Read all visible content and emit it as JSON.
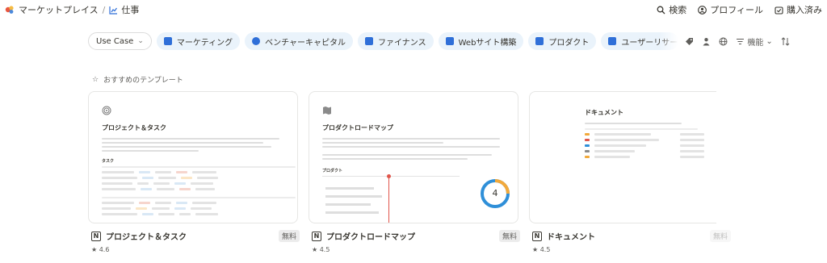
{
  "breadcrumb": {
    "root": "マーケットプレイス",
    "separator": "/",
    "current": "仕事"
  },
  "top_actions": {
    "search": "検索",
    "profile": "プロフィール",
    "purchased": "購入済み"
  },
  "filters": {
    "usecase": "Use Case",
    "chips": [
      {
        "label": "マーケティング",
        "icon": "megaphone-icon"
      },
      {
        "label": "ベンチャーキャピタル",
        "icon": "pie-chart-icon"
      },
      {
        "label": "ファイナンス",
        "icon": "money-icon"
      },
      {
        "label": "Webサイト構築",
        "icon": "monitor-icon"
      },
      {
        "label": "プロダクト",
        "icon": "box-icon"
      },
      {
        "label": "ユーザーリサーチ",
        "icon": "flask-icon"
      }
    ],
    "function_label": "機能"
  },
  "section": {
    "title": "おすすめのテンプレート"
  },
  "cards": [
    {
      "name": "プロジェクト＆タスク",
      "preview_title": "プロジェクト＆タスク",
      "price": "無料",
      "rating": "★ 4.6",
      "subheading": "タスク"
    },
    {
      "name": "プロダクトロードマップ",
      "preview_title": "プロダクトロードマップ",
      "price": "無料",
      "rating": "★ 4.5",
      "subheading": "プロダクト",
      "gauge_value": "4"
    },
    {
      "name": "ドキュメント",
      "preview_title": "ドキュメント",
      "price": "無料",
      "rating": "★ 4.5"
    }
  ],
  "colors": {
    "chip_bg": "#eaf3fb",
    "icon_blue": "#2f6fd8",
    "gauge_orange": "#f2a93b",
    "gauge_blue": "#2f8fd8",
    "timeline_red": "#e0554b"
  }
}
